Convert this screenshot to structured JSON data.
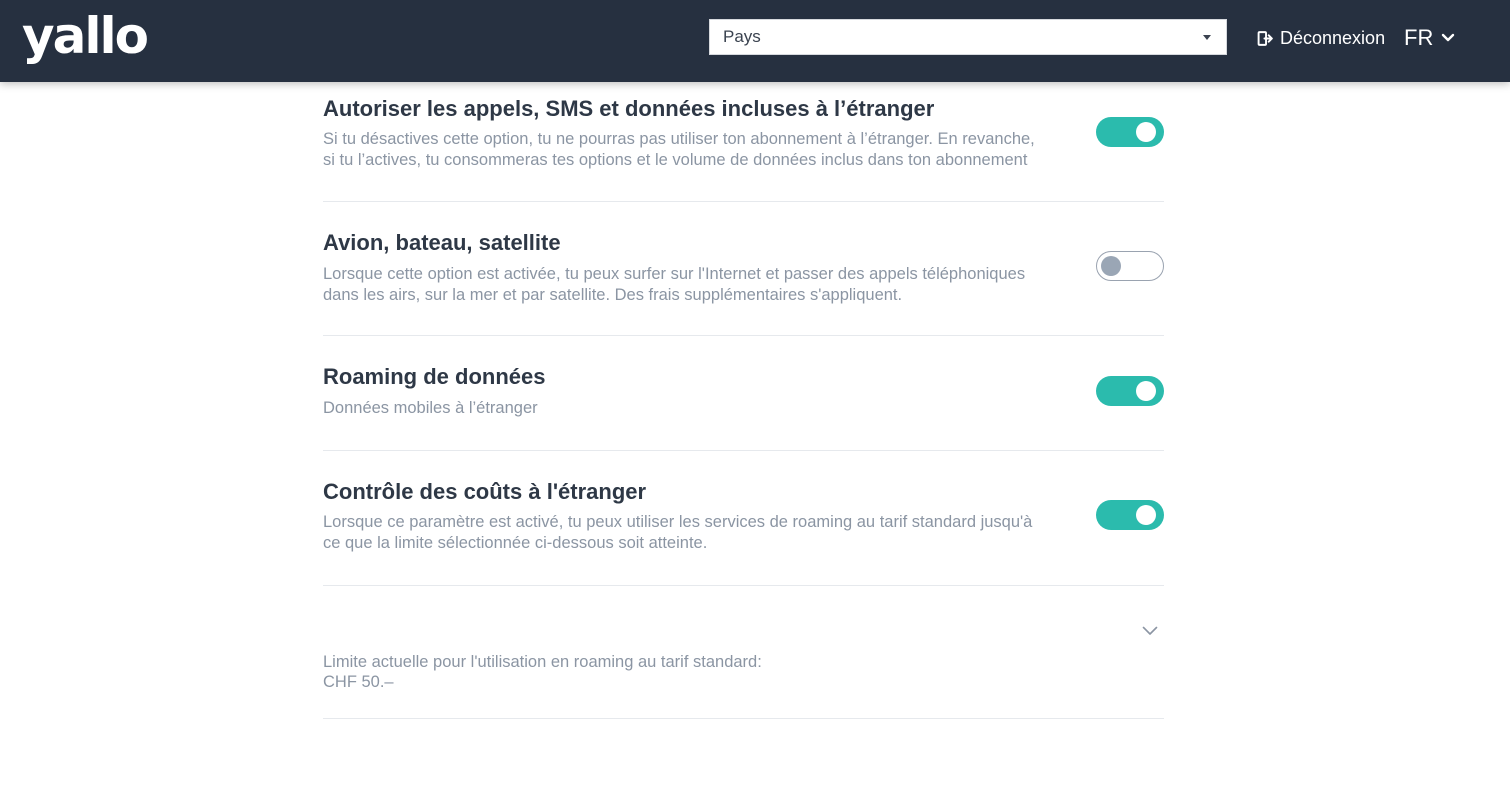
{
  "header": {
    "logo_text": "yallo",
    "country_placeholder": "Pays",
    "logout_label": "Déconnexion",
    "language": "FR"
  },
  "settings": [
    {
      "title": "Autoriser les appels, SMS et données incluses à l’étranger",
      "description_lines": [
        "Si tu désactives cette option, tu ne pourras pas utiliser ton abonnement à l’étranger. En revanche,",
        "si tu l’actives, tu consommeras tes options et le volume de données inclus dans ton abonnement"
      ],
      "enabled": true
    },
    {
      "title": "Avion, bateau, satellite",
      "description_lines": [
        "Lorsque cette option est activée, tu peux surfer sur l'Internet et passer des appels téléphoniques",
        "dans les airs, sur la mer et par satellite. Des frais supplémentaires s'appliquent."
      ],
      "enabled": false
    },
    {
      "title": "Roaming de données",
      "description_lines": [
        "Données mobiles à l’étranger"
      ],
      "enabled": true
    },
    {
      "title": "Contrôle des coûts à l'étranger",
      "description_lines": [
        "Lorsque ce paramètre est activé, tu peux utiliser les services de roaming au tarif standard jusqu'à",
        "ce que la limite sélectionnée ci-dessous soit atteinte."
      ],
      "enabled": true
    }
  ],
  "limit": {
    "label": "Limite actuelle pour l'utilisation en roaming au tarif standard:",
    "value": "CHF 50.–"
  },
  "colors": {
    "header_bg": "#263040",
    "toggle_on": "#2bbbad",
    "toggle_off_knob": "#9aa6b5"
  }
}
